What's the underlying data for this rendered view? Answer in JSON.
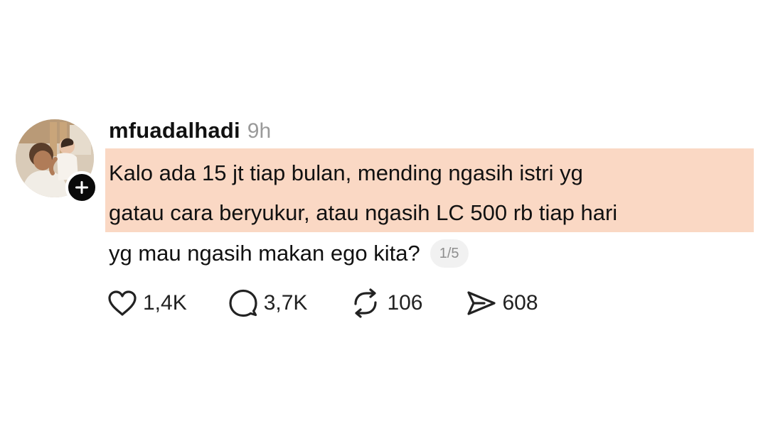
{
  "post": {
    "author": "mfuadalhadi",
    "time": "9h",
    "text_lines": [
      "Kalo ada 15 jt tiap bulan, mending ngasih istri yg",
      "gatau cara beryukur, atau ngasih LC 500 rb tiap hari",
      "yg mau ngasih makan ego kita?"
    ],
    "page_indicator": "1/5",
    "highlight_color": "#fad8c4",
    "follow_icon": "plus-icon"
  },
  "actions": {
    "likes": {
      "icon": "heart-icon",
      "count": "1,4K"
    },
    "replies": {
      "icon": "comment-icon",
      "count": "3,7K"
    },
    "reposts": {
      "icon": "repost-icon",
      "count": "106"
    },
    "shares": {
      "icon": "send-icon",
      "count": "608"
    }
  }
}
